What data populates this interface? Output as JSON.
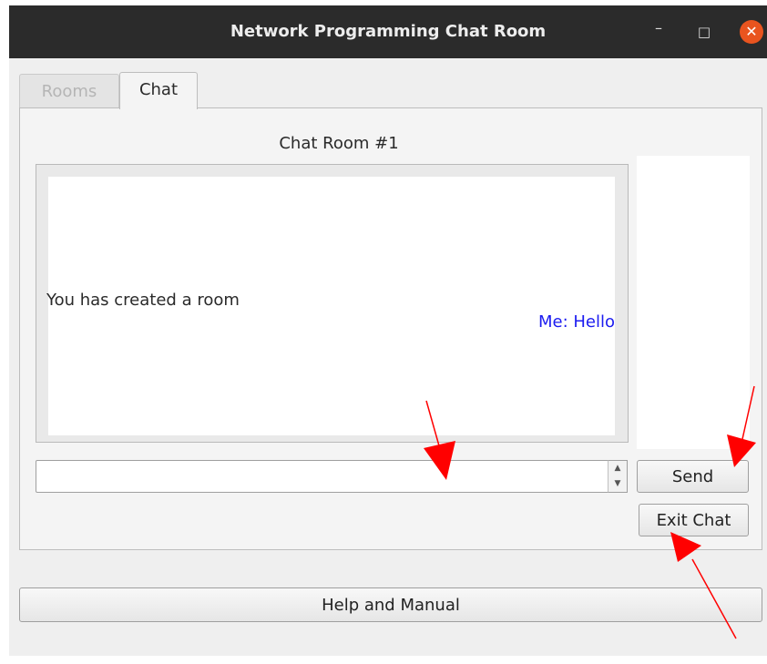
{
  "window": {
    "title": "Network Programming Chat Room",
    "controls": {
      "minimize": "–",
      "maximize": "□",
      "close": "✕"
    }
  },
  "tabs": [
    {
      "label": "Rooms",
      "active": false
    },
    {
      "label": "Chat",
      "active": true
    }
  ],
  "chat": {
    "room_title": "Chat Room #1",
    "messages": [
      {
        "text": "You has created a room",
        "align": "left",
        "color": "#2a2a2a"
      },
      {
        "text": "Me: Hello",
        "align": "right",
        "color": "#1c1cf0"
      }
    ],
    "input": {
      "value": "",
      "placeholder": ""
    },
    "spinner": {
      "up": "▲",
      "down": "▼"
    },
    "send_label": "Send",
    "exit_label": "Exit Chat"
  },
  "footer": {
    "help_label": "Help and Manual"
  },
  "colors": {
    "titlebar": "#2b2b2b",
    "close_button": "#e9541f",
    "own_message": "#1c1cf0",
    "annotation_arrow": "#ff0000"
  }
}
